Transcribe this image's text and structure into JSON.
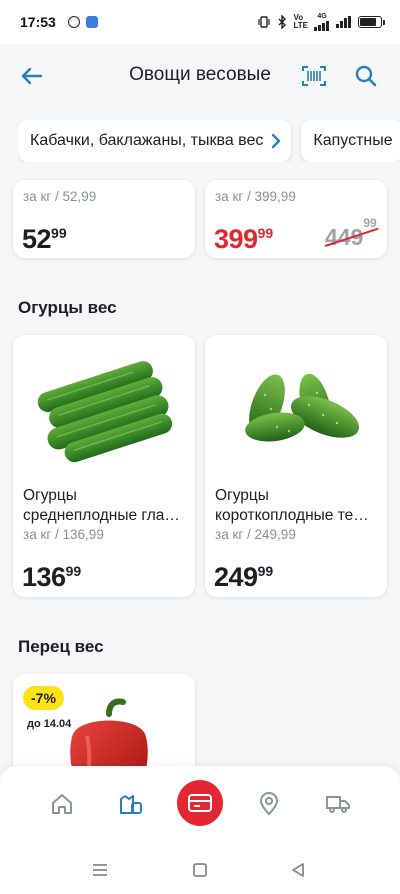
{
  "status": {
    "time": "17:53",
    "net_top": "Vo",
    "net_bottom": "LTE",
    "net_gen": "4G",
    "battery_level": 0.85
  },
  "header": {
    "title": "Овощи весовые",
    "back_icon": "arrow-left-icon",
    "scan_icon": "barcode-scan-icon",
    "search_icon": "search-icon",
    "accent": "#2a7fb8"
  },
  "chips": [
    {
      "label": "Кабачки, баклажаны, тыква вес"
    },
    {
      "label": "Капустные"
    }
  ],
  "top_cards": [
    {
      "unit": "за кг / 52,99",
      "price_int": "52",
      "price_frac": "99"
    },
    {
      "unit": "за кг / 399,99",
      "price_int": "399",
      "price_frac": "99",
      "old_int": "449",
      "old_frac": "99"
    }
  ],
  "sections": [
    {
      "title": "Огурцы вес",
      "products": [
        {
          "name": "Огурцы среднеплодные гла…",
          "unit": "за кг / 136,99",
          "price_int": "136",
          "price_frac": "99"
        },
        {
          "name": "Огурцы короткоплодные те…",
          "unit": "за кг / 249,99",
          "price_int": "249",
          "price_frac": "99"
        }
      ]
    },
    {
      "title": "Перец вес",
      "products": [
        {
          "discount": "-7%",
          "until": "до 14.04"
        }
      ]
    }
  ],
  "colors": {
    "red": "#e3262f",
    "yellow": "#ffe11a",
    "accent_blue": "#2a7fb8"
  }
}
